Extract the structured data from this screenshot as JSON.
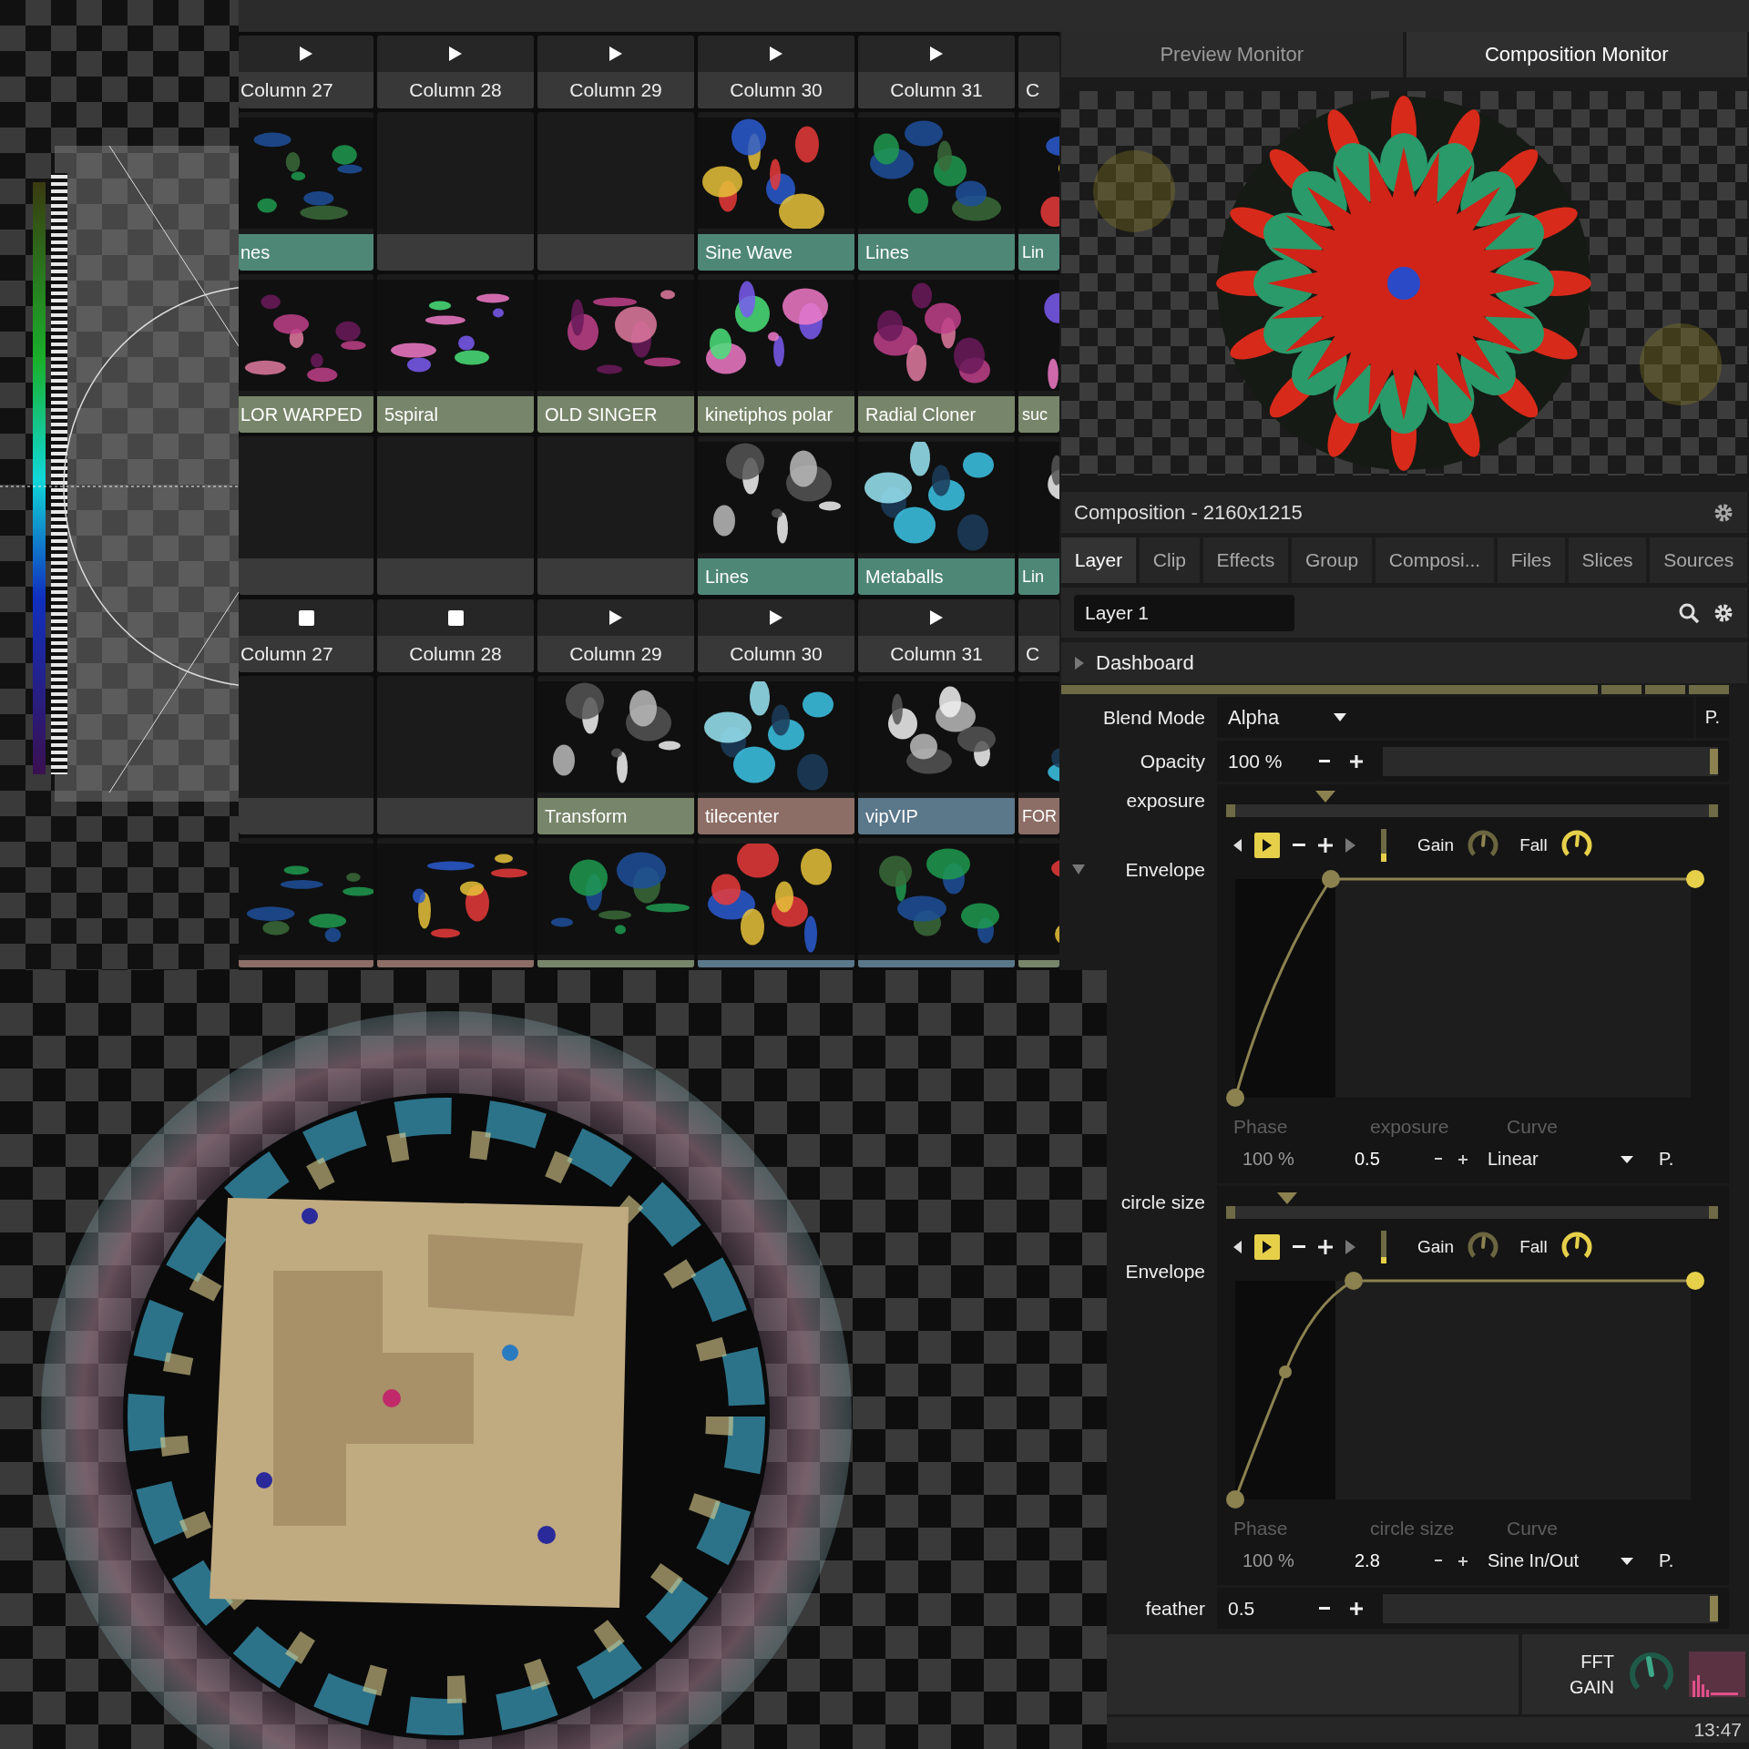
{
  "clip_decks": [
    {
      "columns": [
        {
          "name": "Column 27",
          "stopped": false
        },
        {
          "name": "Column 28",
          "stopped": false
        },
        {
          "name": "Column 29",
          "stopped": false
        },
        {
          "name": "Column 30",
          "stopped": false
        },
        {
          "name": "Column 31",
          "stopped": false
        },
        {
          "name": "C"
        }
      ],
      "rows": [
        {
          "cells": [
            {
              "kind": "clip",
              "label": "nes",
              "color": "#4f8777"
            },
            {
              "kind": "empty"
            },
            {
              "kind": "empty"
            },
            {
              "kind": "clip",
              "label": "Sine Wave",
              "color": "#4f8777"
            },
            {
              "kind": "clip",
              "label": "Lines",
              "color": "#4f8777"
            },
            {
              "kind": "clip",
              "label": "Lin",
              "color": "#4f8777"
            }
          ]
        },
        {
          "cells": [
            {
              "kind": "clip",
              "label": "LOR WARPED",
              "color": "#77866a"
            },
            {
              "kind": "clip",
              "label": "5spiral",
              "color": "#77866a"
            },
            {
              "kind": "clip",
              "label": "OLD SINGER",
              "color": "#77866a"
            },
            {
              "kind": "clip",
              "label": "kinetiphos polar",
              "color": "#77866a"
            },
            {
              "kind": "clip",
              "label": "Radial Cloner",
              "color": "#77866a"
            },
            {
              "kind": "clip",
              "label": "suc",
              "color": "#77866a"
            }
          ]
        },
        {
          "cells": [
            {
              "kind": "empty"
            },
            {
              "kind": "empty"
            },
            {
              "kind": "empty"
            },
            {
              "kind": "clip",
              "label": "Lines",
              "color": "#4f8777"
            },
            {
              "kind": "clip",
              "label": "Metaballs",
              "color": "#4f8777"
            },
            {
              "kind": "clip",
              "label": "Lin",
              "color": "#4f8777"
            }
          ]
        }
      ]
    },
    {
      "columns": [
        {
          "name": "Column 27",
          "stopped": true
        },
        {
          "name": "Column 28",
          "stopped": true
        },
        {
          "name": "Column 29",
          "stopped": false
        },
        {
          "name": "Column 30",
          "stopped": false
        },
        {
          "name": "Column 31",
          "stopped": false
        },
        {
          "name": "C"
        }
      ],
      "rows": [
        {
          "cells": [
            {
              "kind": "empty"
            },
            {
              "kind": "empty"
            },
            {
              "kind": "clip",
              "label": "Transform",
              "color": "#77866a"
            },
            {
              "kind": "clip",
              "label": "tilecenter",
              "color": "#8c6e67"
            },
            {
              "kind": "clip",
              "label": "vipVIP",
              "color": "#5b778a"
            },
            {
              "kind": "clip",
              "label": "FOR",
              "color": "#8c6e67"
            }
          ]
        },
        {
          "cells": [
            {
              "kind": "clip",
              "color": "#8c6e67"
            },
            {
              "kind": "clip",
              "color": "#8c6e67"
            },
            {
              "kind": "clip",
              "color": "#77866a"
            },
            {
              "kind": "clip",
              "color": "#5b778a"
            },
            {
              "kind": "clip",
              "color": "#5b778a"
            },
            {
              "kind": "clip",
              "color": "#77866a"
            }
          ]
        }
      ]
    }
  ],
  "monitor_tabs": [
    {
      "label": "Preview Monitor",
      "selected": false
    },
    {
      "label": "Composition Monitor",
      "selected": true
    }
  ],
  "composition_title": "Composition - 2160x1215",
  "panel_tabs": [
    {
      "label": "Layer",
      "selected": true
    },
    {
      "label": "Clip",
      "selected": false
    },
    {
      "label": "Effects",
      "selected": false
    },
    {
      "label": "Group",
      "selected": false
    },
    {
      "label": "Composi...",
      "selected": false
    },
    {
      "label": "Files",
      "selected": false
    },
    {
      "label": "Slices",
      "selected": false
    },
    {
      "label": "Sources",
      "selected": false
    }
  ],
  "layer_name": "Layer 1",
  "dashboard": {
    "label": "Dashboard",
    "expanded": false
  },
  "parameters": [
    {
      "kind": "dropdown",
      "label": "Blend Mode",
      "value": "Alpha",
      "preset": "P."
    },
    {
      "kind": "slider",
      "label": "Opacity",
      "value": "100 %",
      "level": 1
    },
    {
      "kind": "envelope",
      "label": "exposure",
      "envelope_label": "Envelope",
      "expanded": true,
      "level": 0.19,
      "forward_selected": true,
      "meter": {
        "level": 0.25
      },
      "knobs": [
        {
          "label": "Gain",
          "active": false
        },
        {
          "label": "Fall",
          "active": true
        }
      ],
      "phase_label": "Phase",
      "phase": "100 %",
      "value_label": "exposure",
      "value": "0.5",
      "curve_label": "Curve",
      "curve": "Linear",
      "preset": "P."
    },
    {
      "kind": "envelope",
      "label": "circle size",
      "envelope_label": "Envelope",
      "level": 0.11,
      "forward_selected": true,
      "meter": {
        "level": 0.2
      },
      "knobs": [
        {
          "label": "Gain",
          "active": false
        },
        {
          "label": "Fall",
          "active": true
        }
      ],
      "phase_label": "Phase",
      "phase": "100 %",
      "value_label": "circle size",
      "value": "2.8",
      "curve_label": "Curve",
      "curve": "Sine In/Out",
      "preset": "P."
    },
    {
      "kind": "slider",
      "label": "feather",
      "value": "0.5",
      "level": 1
    }
  ],
  "fft": {
    "lines": [
      "FFT",
      "GAIN"
    ]
  },
  "clock": "13:47"
}
